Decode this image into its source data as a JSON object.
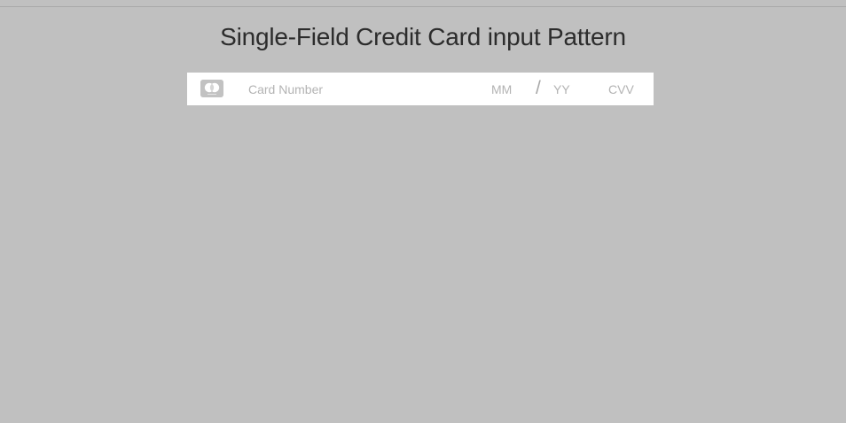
{
  "page": {
    "title": "Single-Field Credit Card input Pattern"
  },
  "card_input": {
    "brand_icon": "mastercard-icon",
    "card_number": {
      "value": "",
      "placeholder": "Card Number"
    },
    "expiry_month": {
      "value": "",
      "placeholder": "MM"
    },
    "separator": "/",
    "expiry_year": {
      "value": "",
      "placeholder": "YY"
    },
    "cvv": {
      "value": "",
      "placeholder": "CVV"
    }
  },
  "colors": {
    "background": "#c0c0c0",
    "field_background": "#ffffff",
    "placeholder": "#b3b3b3",
    "title_text": "#2c2c2c",
    "icon": "#c2c2c2"
  }
}
